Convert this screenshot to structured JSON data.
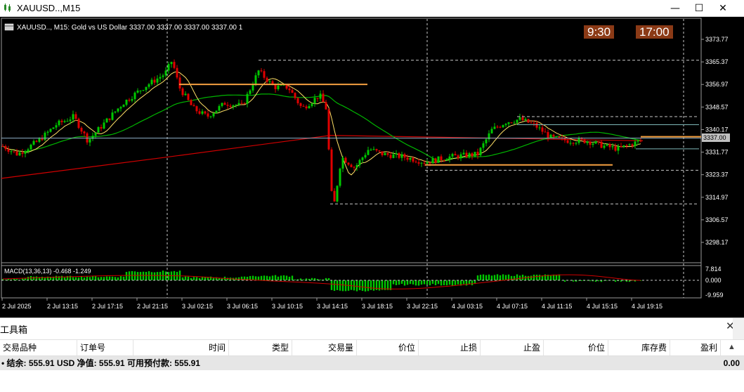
{
  "window": {
    "title": "XAUUSD..,M15",
    "icon": "candlestick-chart-icon",
    "buttons": {
      "minimize": "—",
      "maximize": "☐",
      "close": "✕"
    }
  },
  "chart": {
    "header_text": "XAUUSD.., M15:  Gold vs US Dollar  3337.00 3337.00 3337.00 3337.00  1",
    "badges": [
      "9:30",
      "17:00"
    ],
    "price_labels": [
      "3373.77",
      "3365.37",
      "3356.97",
      "3348.57",
      "3340.17",
      "3331.77",
      "3323.37",
      "3314.97",
      "3306.57",
      "3298.17"
    ],
    "current_price": "3337.00",
    "macd_label": "MACD(13,36,13) -0.468 -1.249",
    "macd_labels": [
      "7.814",
      "0.000",
      "-9.959"
    ],
    "time_labels": [
      "2 Jul 2025",
      "2 Jul 13:15",
      "2 Jul 17:15",
      "2 Jul 21:15",
      "3 Jul 02:15",
      "3 Jul 06:15",
      "3 Jul 10:15",
      "3 Jul 14:15",
      "3 Jul 18:15",
      "3 Jul 22:15",
      "4 Jul 03:15",
      "4 Jul 07:15",
      "4 Jul 11:15",
      "4 Jul 15:15",
      "4 Jul 19:15"
    ],
    "colors": {
      "bull": "#00c800",
      "bear": "#e00000",
      "ma_fast": "#ffe066",
      "ma_mid": "#00b400",
      "ma_slow": "#d00000",
      "level": "#f5a040",
      "badge_bg": "#8b3a16"
    }
  },
  "toolbox": {
    "title": "工具箱",
    "close": "✕",
    "columns": [
      "交易品种",
      "订单号",
      "时间",
      "类型",
      "交易量",
      "价位",
      "止损",
      "止盈",
      "价位",
      "库存费",
      "盈利"
    ],
    "sort_arrow": "▲",
    "balance_text": "• 结余: 555.91 USD  净值: 555.91  可用预付款: 555.91",
    "profit": "0.00"
  }
}
